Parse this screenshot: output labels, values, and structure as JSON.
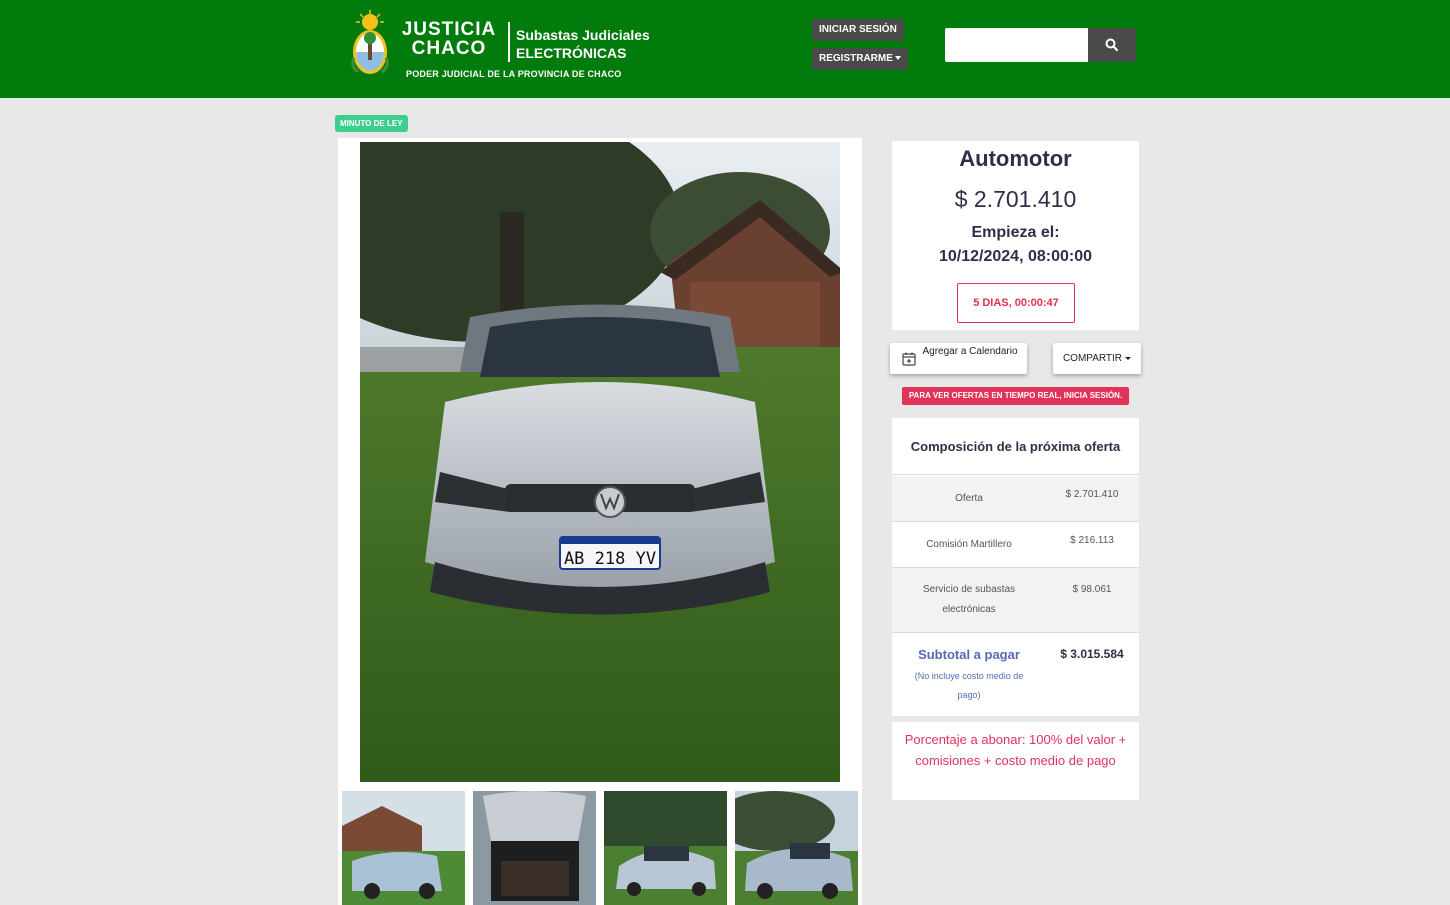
{
  "header": {
    "logo_line1": "JUSTICIA",
    "logo_line2": "CHACO",
    "subastas_line1": "Subastas Judiciales",
    "subastas_line2": "ELECTRÓNICAS",
    "poder": "PODER JUDICIAL DE LA PROVINCIA DE CHACO",
    "login_label": "INICIAR SESIÓN",
    "register_label": "REGISTRARME",
    "search_placeholder": "",
    "search_icon": "search-icon"
  },
  "badge": "MINUTO DE LEY",
  "lot": {
    "title": "Automotor",
    "price": "$ 2.701.410",
    "start_label": "Empieza el:",
    "start_date": "10/12/2024, 08:00:00",
    "countdown": "5 DIAS, 00:00:47"
  },
  "actions": {
    "calendar_label": "Agregar a Calendario",
    "share_label": "COMPARTIR",
    "calendar_icon": "calendar-plus-icon"
  },
  "alert": "PARA VER OFERTAS EN TIEMPO REAL, INICIA SESIÓN.",
  "offer": {
    "title": "Composición de la próxima oferta",
    "rows": [
      {
        "label": "Oferta",
        "value": "$ 2.701.410"
      },
      {
        "label": "Comisión Martillero",
        "value": "$ 216.113"
      },
      {
        "label": "Servicio de subastas electrónicas",
        "value": "$ 98.061"
      }
    ],
    "subtotal_label": "Subtotal a pagar",
    "subtotal_note": "(No incluye costo medio de pago)",
    "subtotal_value": "$ 3.015.584"
  },
  "percentage_note": "Porcentaje a abonar: 100% del valor + comisiones + costo medio de pago",
  "colors": {
    "header_green": "#007b0c",
    "badge_green": "#3ecf8e",
    "alert_red": "#e0335a",
    "navy": "#2d3047",
    "subtotal_blue": "#5868b8"
  }
}
